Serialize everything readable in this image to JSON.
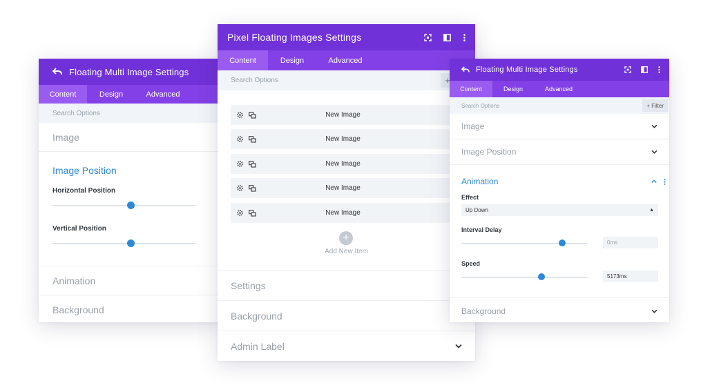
{
  "colors": {
    "header": "#7131d8",
    "tabs": "#8340e6",
    "tab_active": "#9a5bf1",
    "accent_blue": "#2e88d8"
  },
  "left": {
    "title": "Floating Multi Image Settings",
    "tabs": [
      "Content",
      "Design",
      "Advanced"
    ],
    "search_placeholder": "Search Options",
    "sections": {
      "image": "Image",
      "animation": "Animation",
      "background": "Background"
    },
    "image_position": {
      "title": "Image Position",
      "horizontal_label": "Horizontal Position",
      "vertical_label": "Vertical Position",
      "horizontal_value": 0.55,
      "vertical_value": 0.55
    }
  },
  "center": {
    "title": "Pixel Floating Images Settings",
    "tabs": [
      "Content",
      "Design",
      "Advanced"
    ],
    "search_placeholder": "Search Options",
    "items": [
      "New Image",
      "New Image",
      "New Image",
      "New Image",
      "New Image"
    ],
    "add_item_label": "Add New Item",
    "sections": {
      "settings": "Settings",
      "background": "Background",
      "admin_label": "Admin Label"
    }
  },
  "right": {
    "title": "Floating Multi Image Settings",
    "tabs": [
      "Content",
      "Design",
      "Advanced"
    ],
    "search_placeholder": "Search Options",
    "filter_label": "+ Filter",
    "sections": {
      "image": "Image",
      "image_position": "Image Position",
      "background": "Background"
    },
    "animation": {
      "title": "Animation",
      "effect_label": "Effect",
      "effect_value": "Up Down",
      "interval_label": "Interval Delay",
      "interval_value": "0ms",
      "interval_level": 0.8,
      "speed_label": "Speed",
      "speed_value": "5173ms",
      "speed_level": 0.64
    }
  }
}
